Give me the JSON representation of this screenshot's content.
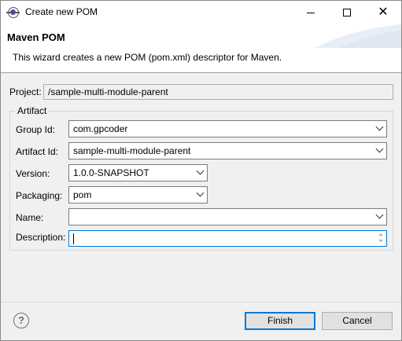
{
  "window": {
    "title": "Create new POM",
    "icon": "eclipse-icon"
  },
  "banner": {
    "title": "Maven POM",
    "description": "This wizard creates a new POM (pom.xml) descriptor for Maven."
  },
  "project": {
    "label": "Project:",
    "value": "/sample-multi-module-parent"
  },
  "artifact": {
    "group_title": "Artifact",
    "group_id": {
      "label": "Group Id:",
      "value": "com.gpcoder"
    },
    "artifact_id": {
      "label": "Artifact Id:",
      "value": "sample-multi-module-parent"
    },
    "version": {
      "label": "Version:",
      "value": "1.0.0-SNAPSHOT"
    },
    "packaging": {
      "label": "Packaging:",
      "value": "pom"
    },
    "name": {
      "label": "Name:",
      "value": ""
    },
    "description": {
      "label": "Description:",
      "value": ""
    }
  },
  "buttons": {
    "finish": "Finish",
    "cancel": "Cancel",
    "help_glyph": "?"
  },
  "colors": {
    "focus": "#0078d7",
    "window_bg": "#f0f0f0",
    "banner_bg": "#ffffff"
  }
}
